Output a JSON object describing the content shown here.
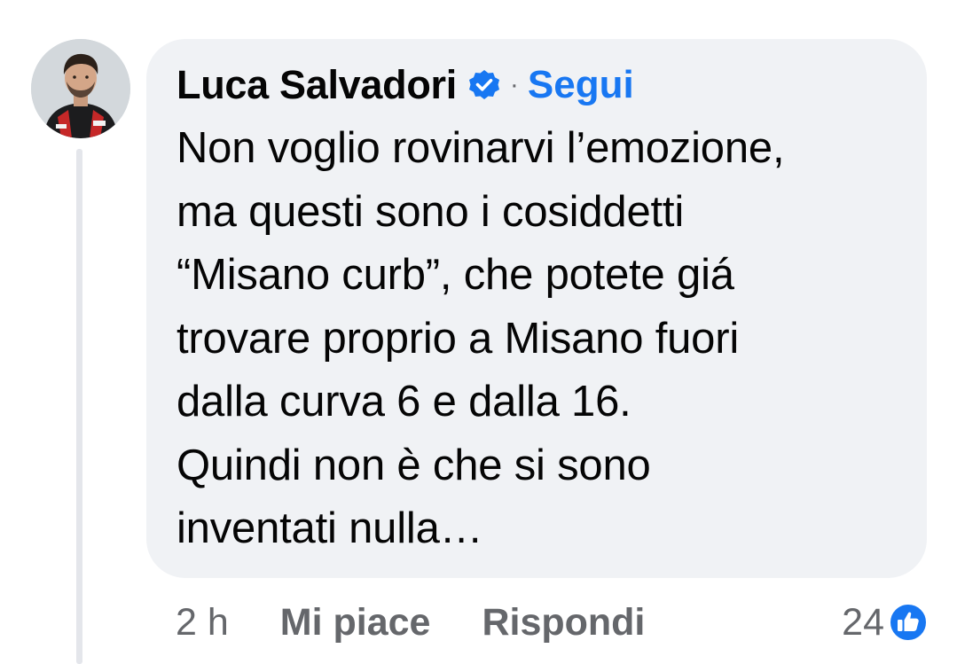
{
  "comment": {
    "author": "Luca Salvadori",
    "verified_icon": "verified-badge-icon",
    "separator": "·",
    "follow_label": "Segui",
    "lines": [
      "Non voglio rovinarvi l’emozione,",
      "ma questi sono i cosiddetti",
      "“Misano curb”, che potete giá",
      "trovare proprio a Misano fuori",
      "dalla curva 6 e dalla 16.",
      "Quindi non è che si sono",
      "inventati nulla…"
    ]
  },
  "actions": {
    "time": "2 h",
    "like_label": "Mi piace",
    "reply_label": "Rispondi"
  },
  "reactions": {
    "count": "24",
    "icon": "thumbs-up-icon"
  },
  "colors": {
    "bubble_bg": "#f0f2f5",
    "follow": "#1877f2",
    "muted": "#65676b",
    "text": "#050505"
  }
}
